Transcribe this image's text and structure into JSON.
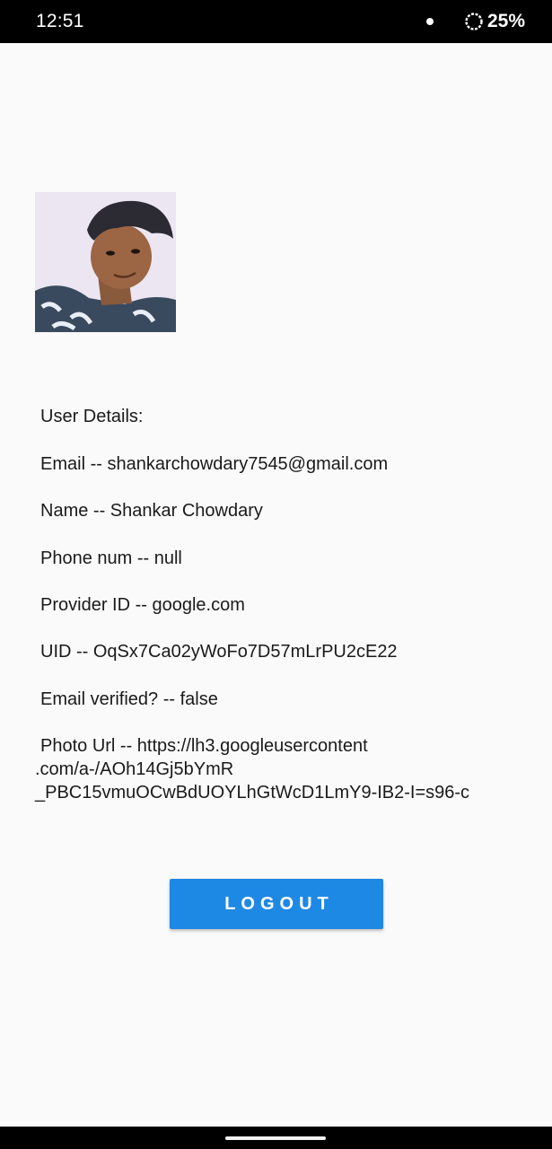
{
  "status_bar": {
    "time": "12:51",
    "battery": "25%"
  },
  "avatar": {
    "icon": "user-profile-photo"
  },
  "details": {
    "heading": "User Details:",
    "email": "Email -- shankarchowdary7545@gmail.com",
    "name": "Name -- Shankar Chowdary",
    "phone": "Phone num -- null",
    "provider": "Provider ID -- google.com",
    "uid": "UID -- OqSx7Ca02yWoFo7D57mLrPU2cE22",
    "email_verified": "Email verified? -- false",
    "photo_url_line1": "Photo Url -- https://lh3.googleusercontent",
    "photo_url_line2": ".com/a-/AOh14Gj5bYmR",
    "photo_url_line3": "_PBC15vmuOCwBdUOYLhGtWcD1LmY9-IB2-I=s96-c"
  },
  "logout_button": {
    "label": "LOGOUT",
    "color": "#1e88e5"
  }
}
